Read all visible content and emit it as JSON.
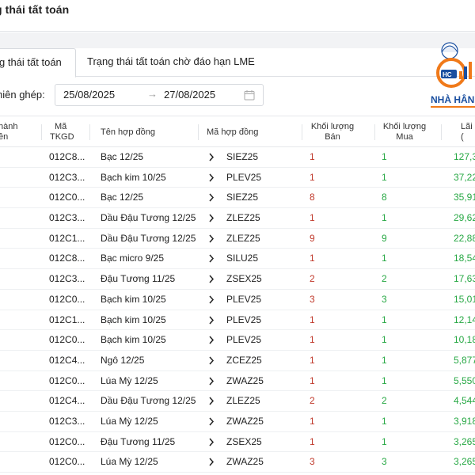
{
  "header": {
    "title": "g thái tất toán"
  },
  "tabs": [
    {
      "label": "g thái tất toán",
      "active": true
    },
    {
      "label": "Trạng thái tất toán chờ đáo hạn LME",
      "active": false
    }
  ],
  "filter": {
    "label": "hiên ghép:",
    "date_from": "25/08/2025",
    "date_sep": "→",
    "date_to": "27/08/2025"
  },
  "logo": {
    "text": "NHÀ HÂN",
    "badge": "HC",
    "colors": {
      "blue": "#1a4fa0",
      "orange": "#f07a1a"
    }
  },
  "table": {
    "headers": {
      "col0_line1": "hành",
      "col0_line2": "ền",
      "col1_line1": "Mã",
      "col1_line2": "TKGD",
      "col2": "Tên hợp đồng",
      "col3": "Mã hợp đồng",
      "col4_line1": "Khối lượng",
      "col4_line2": "Bán",
      "col5_line1": "Khối lượng",
      "col5_line2": "Mua",
      "col6_line1": "Lãi l",
      "col6_line2": "("
    },
    "rows": [
      {
        "tkgd": "012C8...",
        "name": "Bạc 12/25",
        "code": "SIEZ25",
        "ban": "1",
        "mua": "1",
        "lai": "127,3"
      },
      {
        "tkgd": "012C3...",
        "name": "Bạch kim 10/25",
        "code": "PLEV25",
        "ban": "1",
        "mua": "1",
        "lai": "37,22"
      },
      {
        "tkgd": "012C0...",
        "name": "Bạc 12/25",
        "code": "SIEZ25",
        "ban": "8",
        "mua": "8",
        "lai": "35,91"
      },
      {
        "tkgd": "012C3...",
        "name": "Dầu Đậu Tương 12/25",
        "code": "ZLEZ25",
        "ban": "1",
        "mua": "1",
        "lai": "29,62"
      },
      {
        "tkgd": "012C1...",
        "name": "Dầu Đậu Tương 12/25",
        "code": "ZLEZ25",
        "ban": "9",
        "mua": "9",
        "lai": "22,88"
      },
      {
        "tkgd": "012C8...",
        "name": "Bạc micro 9/25",
        "code": "SILU25",
        "ban": "1",
        "mua": "1",
        "lai": "18,54"
      },
      {
        "tkgd": "012C3...",
        "name": "Đậu Tương 11/25",
        "code": "ZSEX25",
        "ban": "2",
        "mua": "2",
        "lai": "17,63"
      },
      {
        "tkgd": "012C0...",
        "name": "Bạch kim 10/25",
        "code": "PLEV25",
        "ban": "3",
        "mua": "3",
        "lai": "15,01"
      },
      {
        "tkgd": "012C1...",
        "name": "Bạch kim 10/25",
        "code": "PLEV25",
        "ban": "1",
        "mua": "1",
        "lai": "12,14"
      },
      {
        "tkgd": "012C0...",
        "name": "Bạch kim 10/25",
        "code": "PLEV25",
        "ban": "1",
        "mua": "1",
        "lai": "10,18"
      },
      {
        "tkgd": "012C4...",
        "name": "Ngô 12/25",
        "code": "ZCEZ25",
        "ban": "1",
        "mua": "1",
        "lai": "5,877"
      },
      {
        "tkgd": "012C0...",
        "name": "Lúa Mỳ 12/25",
        "code": "ZWAZ25",
        "ban": "1",
        "mua": "1",
        "lai": "5,550"
      },
      {
        "tkgd": "012C4...",
        "name": "Dầu Đậu Tương 12/25",
        "code": "ZLEZ25",
        "ban": "2",
        "mua": "2",
        "lai": "4,544"
      },
      {
        "tkgd": "012C3...",
        "name": "Lúa Mỳ 12/25",
        "code": "ZWAZ25",
        "ban": "1",
        "mua": "1",
        "lai": "3,918"
      },
      {
        "tkgd": "012C0...",
        "name": "Đậu Tương 11/25",
        "code": "ZSEX25",
        "ban": "1",
        "mua": "1",
        "lai": "3,265"
      },
      {
        "tkgd": "012C0...",
        "name": "Lúa Mỳ 12/25",
        "code": "ZWAZ25",
        "ban": "3",
        "mua": "3",
        "lai": "3,265"
      }
    ]
  },
  "colors": {
    "sell": "#c0392b",
    "buy": "#27a844",
    "icon": "chevron-right-icon"
  }
}
